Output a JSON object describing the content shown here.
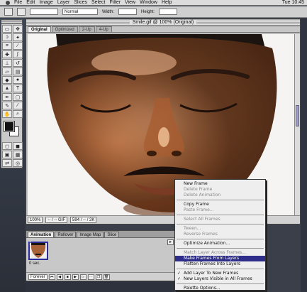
{
  "menubar": {
    "items": [
      "File",
      "Edit",
      "Image",
      "Layer",
      "Slices",
      "Select",
      "Filter",
      "View",
      "Window",
      "Help"
    ],
    "clock": "Tue 10:45"
  },
  "options_bar": {
    "field1": "Normal",
    "label_width": "Width:",
    "label_height": "Height:"
  },
  "document": {
    "title": "Smile.gif @ 100% (Original)",
    "tabs": [
      "Original",
      "Optimized",
      "2-Up",
      "4-Up"
    ],
    "status": {
      "zoom": "100%",
      "format": "-- / -- GIF",
      "size": "594 / -- / 2K"
    }
  },
  "animation_palette": {
    "tabs": [
      "Animation",
      "Rollover",
      "Image Map",
      "Slice"
    ],
    "frames": [
      {
        "number": "1",
        "delay": "0 sec."
      }
    ],
    "loop": "Forever",
    "menu_button": "▸"
  },
  "palette_menu": {
    "groups": [
      [
        {
          "label": "New Frame",
          "enabled": true
        },
        {
          "label": "Delete Frame",
          "enabled": false
        },
        {
          "label": "Delete Animation",
          "enabled": false
        }
      ],
      [
        {
          "label": "Copy Frame",
          "enabled": true
        },
        {
          "label": "Paste Frame...",
          "enabled": false
        }
      ],
      [
        {
          "label": "Select All Frames",
          "enabled": false
        }
      ],
      [
        {
          "label": "Tween...",
          "enabled": false
        },
        {
          "label": "Reverse Frames",
          "enabled": false
        }
      ],
      [
        {
          "label": "Optimize Animation...",
          "enabled": true
        }
      ],
      [
        {
          "label": "Match Layer Across Frames...",
          "enabled": false
        },
        {
          "label": "Make Frames From Layers",
          "enabled": true,
          "selected": true
        },
        {
          "label": "Flatten Frames Into Layers",
          "enabled": true
        }
      ],
      [
        {
          "label": "Add Layer To New Frames",
          "enabled": true,
          "checked": true
        },
        {
          "label": "New Layers Visible in All Frames",
          "enabled": true,
          "checked": true
        }
      ],
      [
        {
          "label": "Palette Options...",
          "enabled": true
        }
      ]
    ]
  },
  "colors": {
    "accent": "#2e2e8a",
    "foreground_swatch": "#111111",
    "background_swatch": "#ffffff"
  }
}
